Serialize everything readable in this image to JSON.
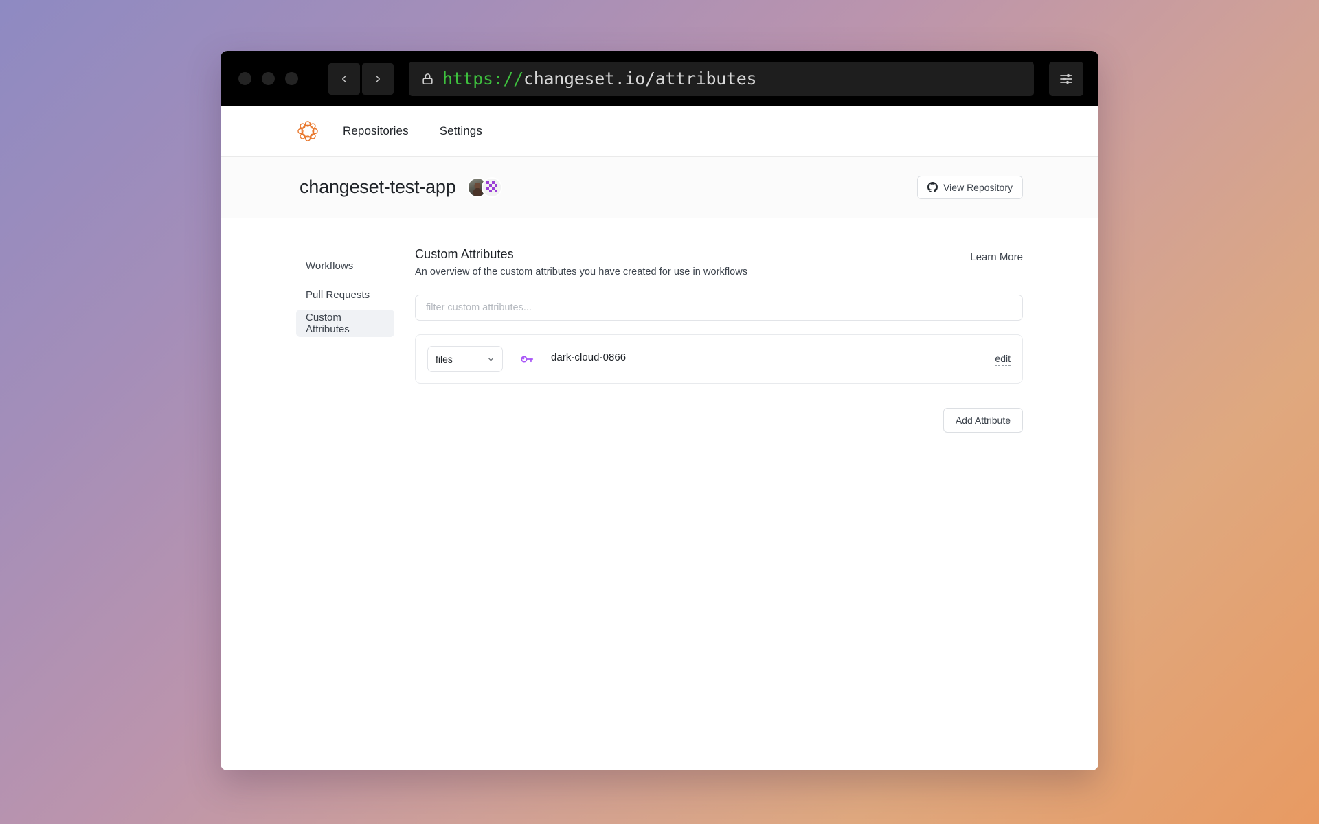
{
  "browser": {
    "traffic_lights": [
      "close",
      "minimize",
      "maximize"
    ],
    "back_label": "Back",
    "forward_label": "Forward",
    "url_scheme": "https://",
    "url_host": "changeset.io/attributes",
    "lock_icon": "lock-icon",
    "menu_icon": "sliders-icon"
  },
  "app_nav": {
    "logo_icon": "changeset-logo",
    "links": [
      {
        "label": "Repositories"
      },
      {
        "label": "Settings"
      }
    ]
  },
  "repo_header": {
    "title": "changeset-test-app",
    "avatars": [
      "user-photo-avatar",
      "identicon-avatar"
    ],
    "view_repository": {
      "label": "View Repository",
      "icon": "github-icon"
    }
  },
  "sidebar": {
    "items": [
      {
        "label": "Workflows",
        "active": false
      },
      {
        "label": "Pull Requests",
        "active": false
      },
      {
        "label": "Custom Attributes",
        "active": true
      }
    ]
  },
  "content": {
    "title": "Custom Attributes",
    "subtitle": "An overview of the custom attributes you have created for use in workflows",
    "learn_more_label": "Learn More",
    "filter": {
      "placeholder": "filter custom attributes...",
      "value": ""
    },
    "attributes": [
      {
        "type": "files",
        "type_chevron": "chevron-down-icon",
        "key_icon": "key-icon",
        "name": "dark-cloud-0866",
        "edit_label": "edit"
      }
    ],
    "add_attribute_label": "Add Attribute"
  },
  "colors": {
    "accent_orange": "#e8762b",
    "key_purple": "#a855f7",
    "url_green": "#3ec03e",
    "gradient_start": "#8e8ac2",
    "gradient_end": "#e89a62",
    "sidebar_active_bg": "#f0f2f5"
  }
}
